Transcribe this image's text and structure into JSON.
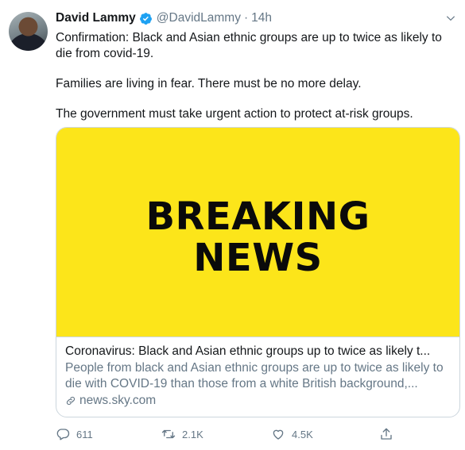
{
  "tweet": {
    "author_name": "David Lammy",
    "handle": "@DavidLammy",
    "separator": "·",
    "time": "14h",
    "paragraphs": [
      "Confirmation: Black and Asian ethnic groups are up to twice as likely to die from covid-19.",
      "Families are living in fear. There must be no more delay.",
      "The government must take urgent action to protect at-risk groups."
    ]
  },
  "card": {
    "image_line1": "BREAKING",
    "image_line2": "NEWS",
    "title": "Coronavirus: Black and Asian ethnic groups up to twice as likely t...",
    "description": "People from black and Asian ethnic groups are up to twice as likely to die with COVID-19 than those from a white British background,...",
    "domain": "news.sky.com"
  },
  "actions": {
    "replies": "611",
    "retweets": "2.1K",
    "likes": "4.5K"
  },
  "colors": {
    "image_background": "#fce51a",
    "verified_badge": "#1da1f2",
    "secondary_text": "#657786"
  }
}
